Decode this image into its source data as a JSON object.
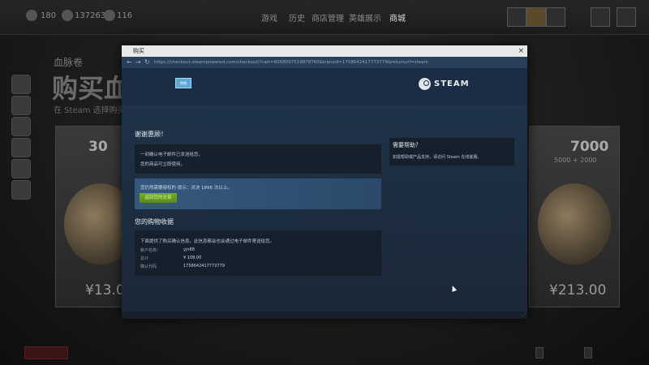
{
  "game": {
    "topbar": {
      "stat1": "180",
      "stat2": "137263",
      "stat3": "116",
      "menu": [
        "游戏",
        "历史",
        "商店管理",
        "英雄展示",
        "商城"
      ]
    },
    "page": {
      "small_title": "血脉卷",
      "big_title": "购买血",
      "subtitle": "在 Steam 选择购买血"
    },
    "cards": {
      "left": {
        "amount": "30",
        "price": "¥13.0"
      },
      "right": {
        "amount": "7000",
        "bonus": "5000 + 2000",
        "price": "¥213.00"
      }
    }
  },
  "window": {
    "title": "购买",
    "close_icon": "×",
    "nav": {
      "back_icon": "←",
      "forward_icon": "→",
      "reload_icon": "↻",
      "lock_icon": "lock",
      "url": "https://checkout.steampowered.com/checkout/?cart=6058097519878760&transid=1758642417773779&returnurl=steam"
    },
    "header": {
      "cloud_label": "购物",
      "logo_text": "STEAM"
    },
    "thanks": {
      "heading": "谢谢惠顾！",
      "line1": "一封确认电子邮件已发送给您。",
      "line2": "您的商品可立即使用。"
    },
    "notice": {
      "text": "您仍然需要授权的 提示：对决 1896 次以上。",
      "button": "返回您的交易"
    },
    "receipt": {
      "heading": "您的购物收据",
      "intro": "下面提供了购买确认信息。此信息都会也会通过电子邮件寄送给您。",
      "rows": [
        {
          "key": "帐户名称：",
          "value": "yjn88"
        },
        {
          "key": "总计",
          "value": "¥ 108.00"
        },
        {
          "key": "确认代码",
          "value": "1758642417773779"
        }
      ]
    },
    "help": {
      "heading": "需要帮助？",
      "text": "如需帮助或产品支持，请访问 Steam 在线客服。"
    }
  }
}
